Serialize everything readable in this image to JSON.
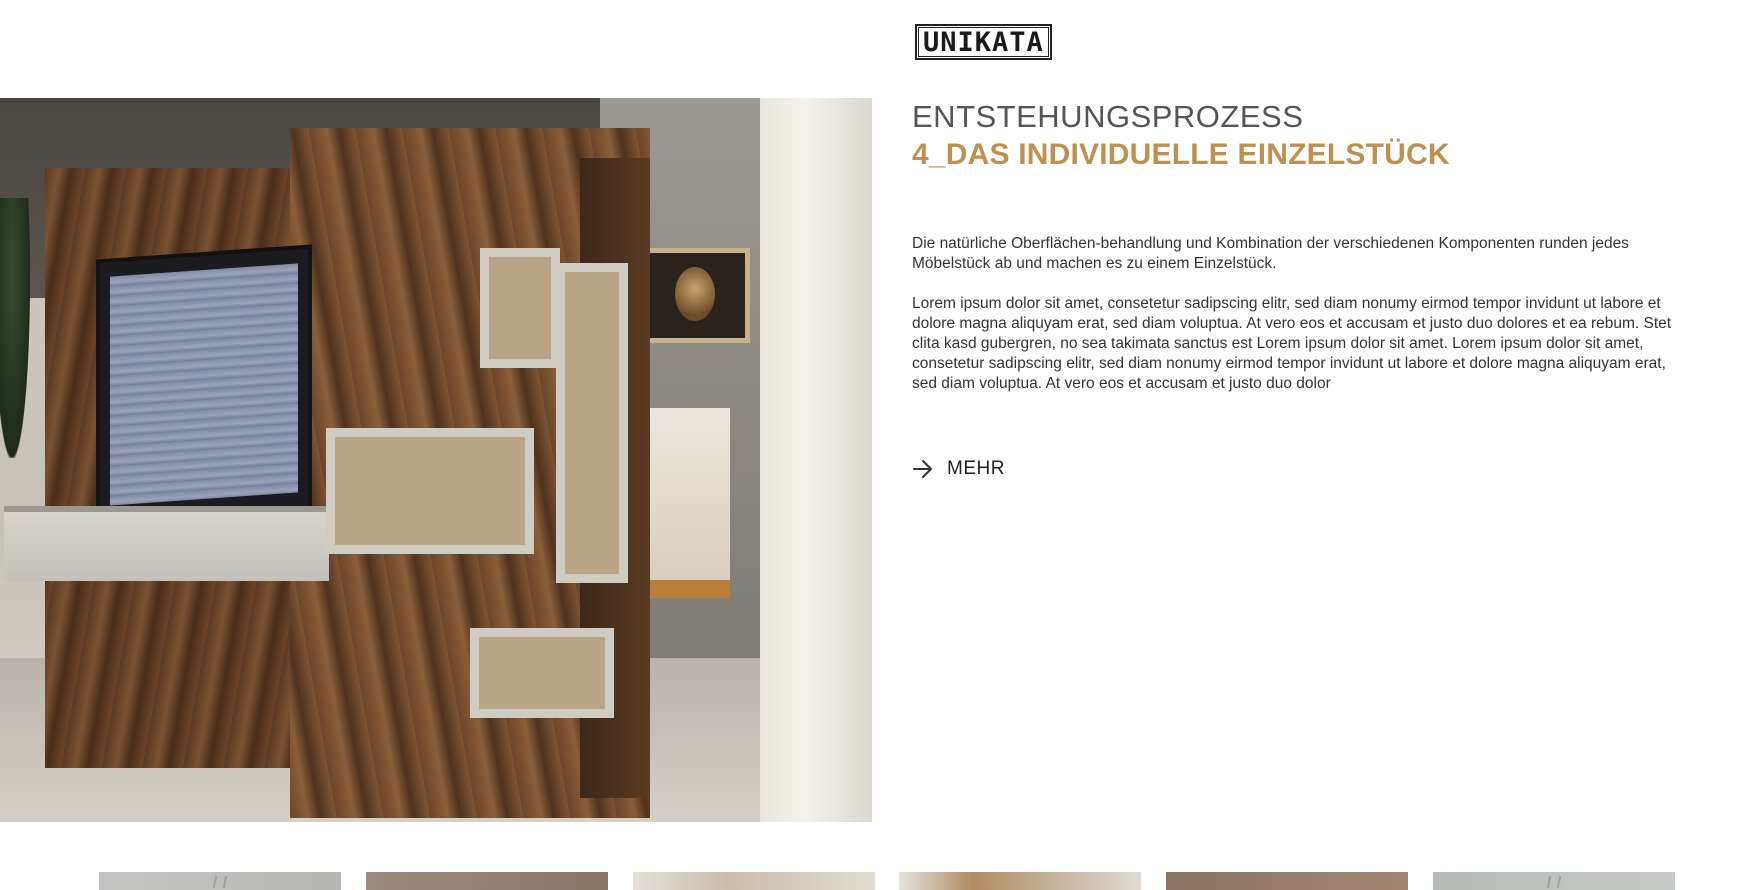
{
  "header": {
    "logo_text": "UNIKATA"
  },
  "hero": {
    "image_alt": "Wohnwand aus Altholz mit Fernseher und weißen Regalboxen"
  },
  "main": {
    "eyebrow": "ENTSTEHUNGSPROZESS",
    "title": "4_DAS INDIVIDUELLE EINZELSTÜCK",
    "paragraph_1": "Die natürliche Oberflächen-behandlung und Kombination der verschiedenen Komponenten runden jedes Möbelstück ab und machen es zu einem Einzelstück.",
    "paragraph_2": "Lorem ipsum dolor sit amet, consetetur sadipscing elitr, sed diam nonumy eirmod tempor invidunt ut labore et dolore magna aliquyam erat, sed diam voluptua. At vero eos et accusam et justo duo dolores et ea rebum. Stet clita kasd gubergren, no sea takimata sanctus est Lorem ipsum dolor sit amet. Lorem ipsum dolor sit amet, consetetur sadipscing elitr, sed diam nonumy eirmod tempor invidunt ut labore et dolore magna aliquyam erat, sed diam voluptua. At vero eos et accusam et justo duo dolor",
    "more_label": "MEHR",
    "more_icon": "arrow-right-icon"
  },
  "colors": {
    "accent": "#bf9050",
    "text": "#333333",
    "background": "#ffffff"
  }
}
